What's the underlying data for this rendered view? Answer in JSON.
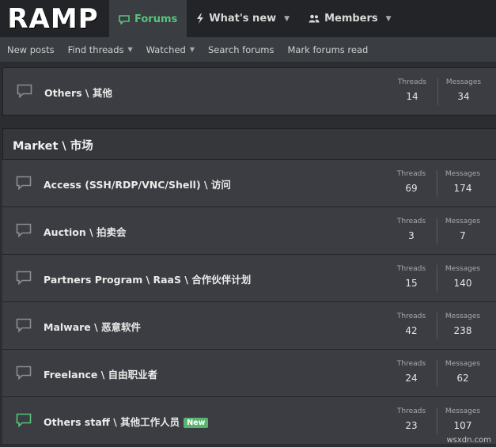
{
  "logo": "RAMP",
  "nav": {
    "tabs": [
      {
        "label": "Forums",
        "icon": "forums-icon"
      },
      {
        "label": "What's new",
        "icon": "lightning-icon"
      },
      {
        "label": "Members",
        "icon": "members-icon"
      }
    ]
  },
  "subnav": [
    "New posts",
    "Find threads",
    "Watched",
    "Search forums",
    "Mark forums read"
  ],
  "labels": {
    "threads": "Threads",
    "messages": "Messages",
    "new": "New"
  },
  "top_forum": {
    "title": "Others \\ 其他",
    "threads": "14",
    "messages": "34"
  },
  "category": {
    "title": "Market \\ 市场"
  },
  "forums": [
    {
      "title": "Access (SSH/RDP/VNC/Shell) \\ 访问",
      "threads": "69",
      "messages": "174",
      "is_new": false
    },
    {
      "title": "Auction \\ 拍卖会",
      "threads": "3",
      "messages": "7",
      "is_new": false
    },
    {
      "title": "Partners Program \\ RaaS \\ 合作伙伴计划",
      "threads": "15",
      "messages": "140",
      "is_new": false
    },
    {
      "title": "Malware \\ 恶意软件",
      "threads": "42",
      "messages": "238",
      "is_new": false
    },
    {
      "title": "Freelance \\ 自由职业者",
      "threads": "24",
      "messages": "62",
      "is_new": false
    },
    {
      "title": "Others staff \\ 其他工作人员",
      "threads": "23",
      "messages": "107",
      "is_new": true
    }
  ],
  "watermark": "wsxdn.com",
  "colors": {
    "accent": "#57c47a",
    "bg": "#2b2d31",
    "row": "#3b3d42"
  }
}
